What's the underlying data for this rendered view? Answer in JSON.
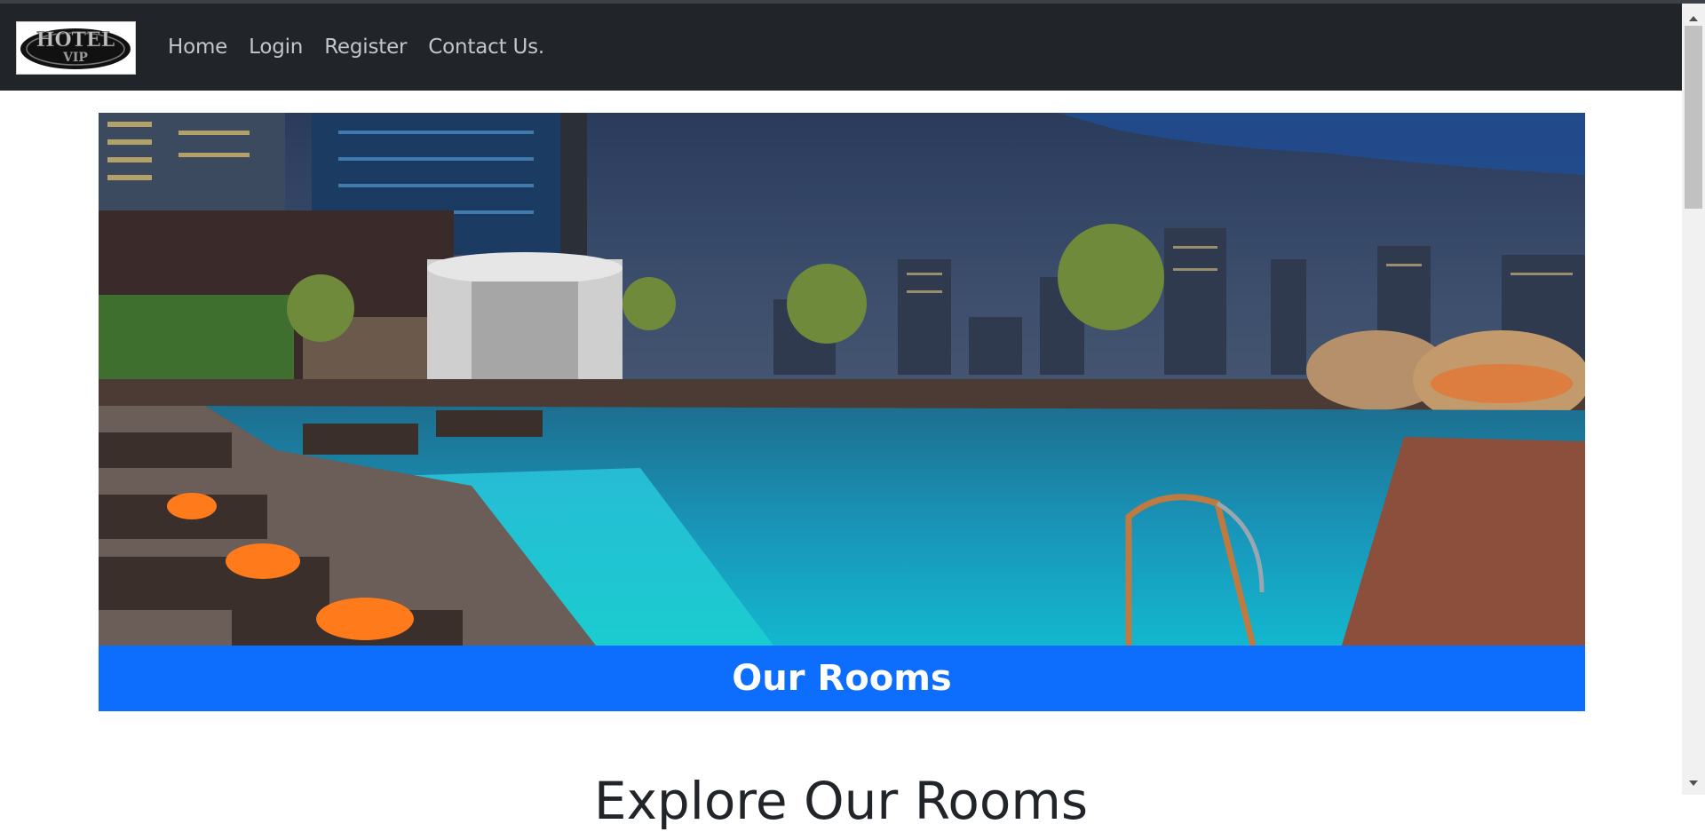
{
  "brand": {
    "logo_text": "HOTEL VIP",
    "logo_alt": "Hotel VIP logo"
  },
  "nav": {
    "items": [
      {
        "label": "Home"
      },
      {
        "label": "Login"
      },
      {
        "label": "Register"
      },
      {
        "label": "Contact Us."
      }
    ]
  },
  "hero": {
    "image_description": "Rooftop pool at night with city skyline"
  },
  "banner": {
    "title": "Our Rooms"
  },
  "section": {
    "title": "Explore Our Rooms"
  },
  "colors": {
    "navbar_bg": "#212529",
    "nav_link": "#c3c6c9",
    "banner_bg": "#0d6efd",
    "banner_text": "#ffffff",
    "heading_text": "#212529"
  }
}
